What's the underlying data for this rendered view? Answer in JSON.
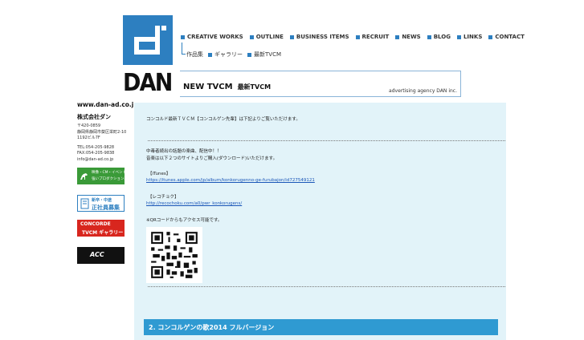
{
  "logo": {
    "text": "DAN"
  },
  "nav": {
    "items": [
      "CREATIVE WORKS",
      "OUTLINE",
      "BUSINESS ITEMS",
      "RECRUIT",
      "NEWS",
      "BLOG",
      "LINKS",
      "CONTACT"
    ],
    "subitems": [
      "作品集",
      "ギャラリー",
      "最新TVCM"
    ],
    "accent_color": "#2d7fc0"
  },
  "banner": {
    "title": "NEW TVCM",
    "title_ja": "最新TVCM",
    "agency": "advertising agency DAN inc."
  },
  "sidebar": {
    "url": "www.dan-ad.co.jp",
    "company": "株式会社ダン",
    "address": [
      "〒420-0859",
      "静岡県静岡市葵区栄町2-10",
      "1192ビル7F"
    ],
    "contact": [
      "TEL:054-205-9828",
      "FAX:054-205-9838",
      "info@dan-ad.co.jp"
    ],
    "badges": [
      {
        "name": "production-badge",
        "text": "映像・CM・イベントに 強いプロダクション募集",
        "color": "#3a9a38"
      },
      {
        "name": "recruit-badge",
        "text_top": "新卒・中途",
        "text_main": "正社員募集",
        "color": "#2d7fc0"
      },
      {
        "name": "concorde-badge",
        "text_top": "CONCORDE",
        "text_main": "TVCM ギャラリー",
        "color": "#d8261e"
      },
      {
        "name": "acc-badge",
        "text": "ACC",
        "color": "#111111"
      }
    ]
  },
  "content": {
    "intro": "コンコルド最新ＴＶＣＭ【コンコルゲン先輩】は下記よりご覧いただけます。",
    "line1": "中毒者続出の話題の楽曲、配信中！！",
    "line2": "音楽は以下２つのサイトよりご購入(ダウンロード)いただけます。",
    "itunes_label": "【iTunes】",
    "itunes_url": "https://itunes.apple.com/jp/album/konkorugenno-ge-furubajon/id727549121",
    "recochoku_label": "【レコチョク】",
    "recochoku_url": "http://recochoku.com/a0/pwr_konkorugens/",
    "qr_note": "※QRコードからもアクセス可能です。",
    "section_title": "2. コンコルゲンの歌2014 フルバージョン",
    "section_color": "#2f9ad2",
    "background_color": "#e2f3f9"
  }
}
